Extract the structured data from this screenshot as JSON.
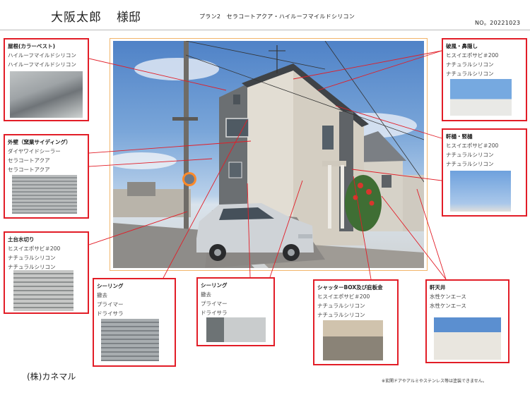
{
  "header": {
    "customer_name": "大阪太郎",
    "honorific": "様邸",
    "plan_title": "プラン2　セラコートアクア・ハイルーフマイルドシリコン",
    "doc_number": "NO。20221023"
  },
  "annotations": {
    "roof": {
      "title": "屋根(カラーベスト)",
      "lines": [
        "ハイルーフマイルドシリコン",
        "ハイルーフマイルドシリコン"
      ]
    },
    "wall": {
      "title": "外壁（窯業サイディング）",
      "lines": [
        "ダイヤワイドシーラー",
        "セラコートアクア",
        "セラコートアクア"
      ]
    },
    "sill": {
      "title": "土台水切り",
      "lines": [
        "ヒスイエポサビ＃200",
        "ナチュラルシリコン",
        "ナチュラルシリコン"
      ]
    },
    "sealing_left": {
      "title": "シーリング",
      "lines": [
        "撤去",
        "プライマー",
        "ドライサラ"
      ]
    },
    "sealing_right": {
      "title": "シーリング",
      "lines": [
        "撤去",
        "プライマー",
        "ドライサラ"
      ]
    },
    "shutter": {
      "title": "シャッターBOX及び庇板金",
      "lines": [
        "ヒスイエポサビ＃200",
        "ナチュラルシリコン",
        "ナチュラルシリコン"
      ]
    },
    "soffit": {
      "title": "軒天井",
      "lines": [
        "水性ケンエース",
        "水性ケンエース"
      ]
    },
    "wind_board": {
      "title": "破風・鼻隠し",
      "lines": [
        "ヒスイエポサビ＃200",
        "ナチュラルシリコン",
        "ナチュラルシリコン"
      ]
    },
    "gutter": {
      "title": "軒樋・竪樋",
      "lines": [
        "ヒスイエポサビ＃200",
        "ナチュラルシリコン",
        "ナチュラルシリコン"
      ]
    }
  },
  "footer": {
    "company": "(株)カネマル",
    "note": "※玄関ドアやアルミやステンレス等は塗装できません。"
  },
  "colors": {
    "annotation_border": "#e21d27",
    "photo_frame": "#f2b56a"
  }
}
